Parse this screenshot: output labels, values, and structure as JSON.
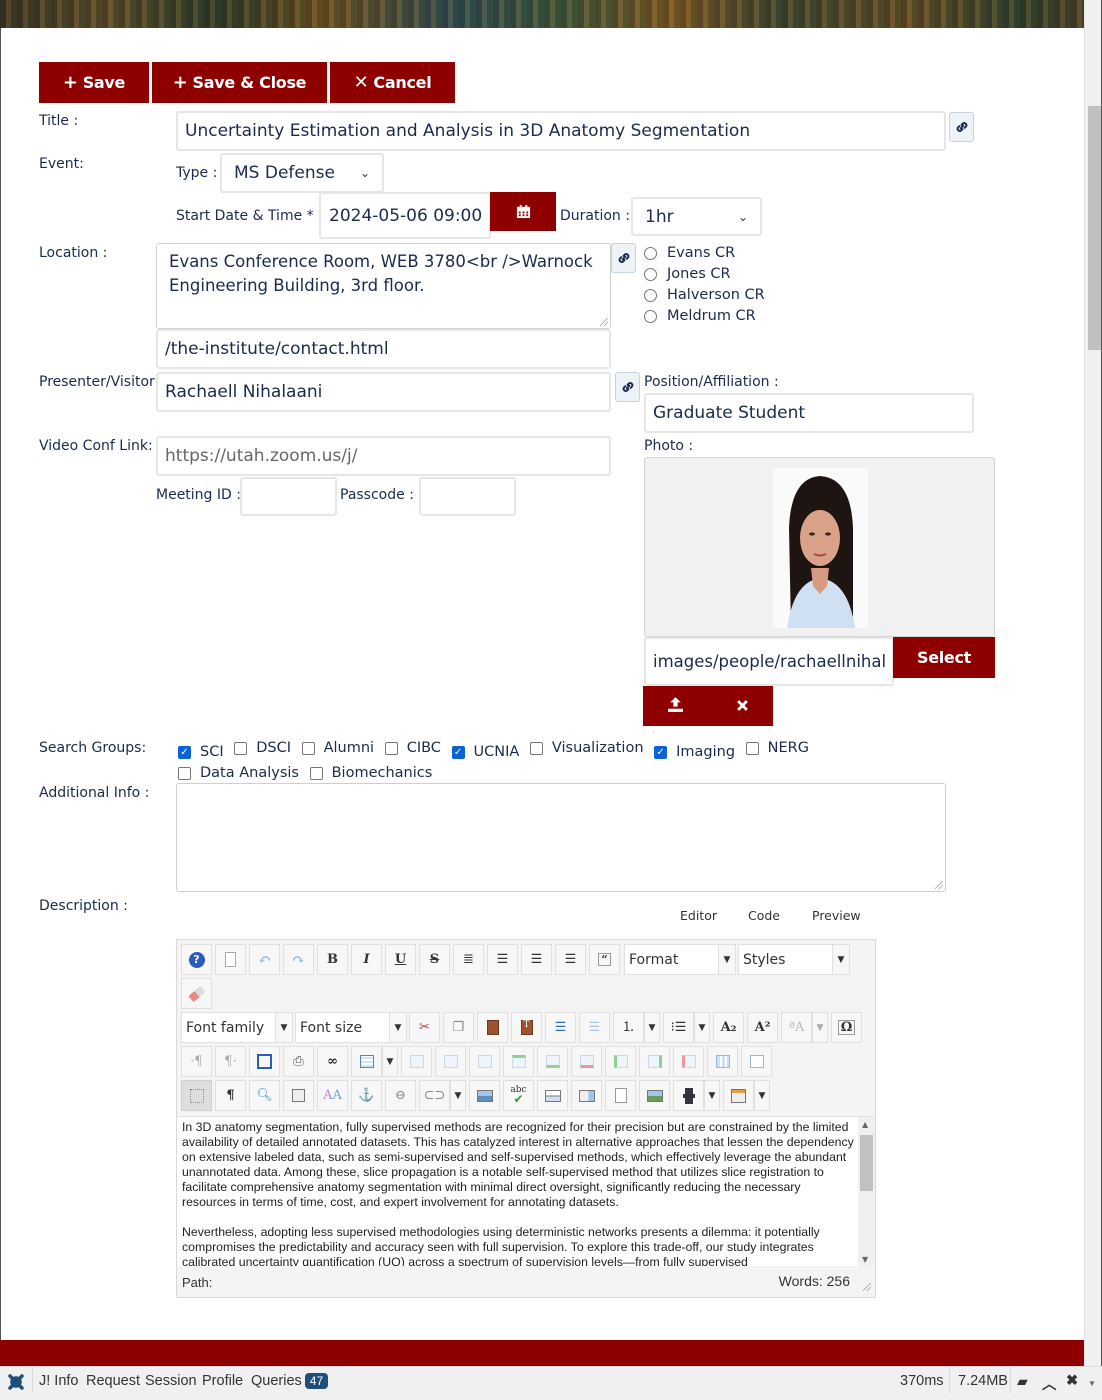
{
  "toolbar": {
    "save_label": "Save",
    "save_close_label": "Save & Close",
    "cancel_label": "Cancel"
  },
  "form": {
    "title_label": "Title :",
    "title_value": "Uncertainty Estimation and Analysis in 3D Anatomy Segmentation",
    "event_label": "Event:",
    "type_label": "Type :",
    "type_value": "MS Defense",
    "start_label": "Start Date & Time * :",
    "start_value": "2024-05-06 09:00",
    "duration_label": "Duration :",
    "duration_value": "1hr",
    "location_label": "Location :",
    "location_value": "Evans Conference Room, WEB 3780<br />Warnock Engineering Building, 3rd floor.",
    "location_url": "/the-institute/contact.html",
    "location_options": [
      "Evans CR",
      "Jones CR",
      "Halverson CR",
      "Meldrum CR"
    ],
    "presenter_label": "Presenter/Visitor:",
    "presenter_value": "Rachaell Nihalaani",
    "position_label": "Position/Affiliation :",
    "position_value": "Graduate Student",
    "photo_label": "Photo :",
    "photo_path": "images/people/rachaellnihal",
    "photo_select_label": "Select",
    "video_label": "Video Conf Link:",
    "video_placeholder": "https://utah.zoom.us/j/",
    "meeting_id_label": "Meeting ID :",
    "meeting_id_value": "",
    "passcode_label": "Passcode :",
    "passcode_value": "",
    "search_groups_label": "Search Groups:",
    "search_groups": [
      {
        "label": "SCI",
        "checked": true
      },
      {
        "label": "DSCI",
        "checked": false
      },
      {
        "label": "Alumni",
        "checked": false
      },
      {
        "label": "CIBC",
        "checked": false
      },
      {
        "label": "UCNIA",
        "checked": true
      },
      {
        "label": "Visualization",
        "checked": false
      },
      {
        "label": "Imaging",
        "checked": true
      },
      {
        "label": "NERG",
        "checked": false
      },
      {
        "label": "Data Analysis",
        "checked": false
      },
      {
        "label": "Biomechanics",
        "checked": false
      }
    ],
    "additional_info_label": "Additional Info :",
    "additional_info_value": "",
    "description_label": "Description :"
  },
  "editor": {
    "tabs": [
      "Editor",
      "Code",
      "Preview"
    ],
    "format_label": "Format",
    "styles_label": "Styles",
    "font_family_label": "Font family",
    "font_size_label": "Font size",
    "paragraphs": [
      "In 3D anatomy segmentation, fully supervised methods are recognized for their precision but are constrained by the limited availability of detailed annotated datasets. This has catalyzed interest in alternative approaches that lessen the dependency on extensive labeled data, such as semi-supervised and self-supervised methods, which effectively leverage the abundant unannotated data. Among these, slice propagation is a notable self-supervised method that utilizes slice registration to facilitate comprehensive anatomy segmentation with minimal direct oversight, significantly reducing the necessary resources in terms of time, cost, and expert involvement for annotating datasets.",
      "Nevertheless, adopting less supervised methodologies using deterministic networks presents a dilemma: it potentially compromises the predictability and accuracy seen with full supervision. To explore this trade-off, our study integrates calibrated uncertainty quantification (UQ) across a spectrum of supervision levels—from fully supervised"
    ],
    "path_label": "Path:",
    "word_count": "Words: 256"
  },
  "debugbar": {
    "items": [
      "J! Info",
      "Request",
      "Session",
      "Profile",
      "Queries"
    ],
    "queries_count": "47",
    "time": "370ms",
    "memory": "7.24MB"
  },
  "colors": {
    "brand_red": "#8e0000",
    "text_navy": "#1b2a4e",
    "checkbox_blue": "#0b62d6"
  }
}
